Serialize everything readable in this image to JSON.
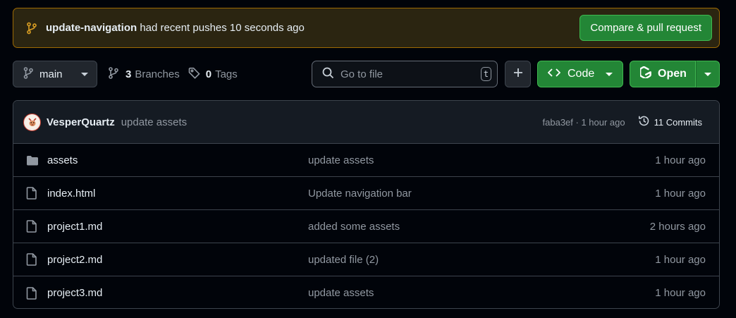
{
  "banner": {
    "branch": "update-navigation",
    "message": "had recent pushes 10 seconds ago",
    "compare_button": "Compare & pull request"
  },
  "toolbar": {
    "branch_selector": "main",
    "branches_count": "3",
    "branches_label": "Branches",
    "tags_count": "0",
    "tags_label": "Tags",
    "search_placeholder": "Go to file",
    "search_shortcut": "t",
    "code_button": "Code",
    "open_button": "Open"
  },
  "latest_commit": {
    "author": "VesperQuartz",
    "message": "update assets",
    "hash_time": "faba3ef · 1 hour ago",
    "commits_label": "11 Commits"
  },
  "files": [
    {
      "name": "assets",
      "type": "folder",
      "message": "update assets",
      "time": "1 hour ago"
    },
    {
      "name": "index.html",
      "type": "file",
      "message": "Update navigation bar",
      "time": "1 hour ago"
    },
    {
      "name": "project1.md",
      "type": "file",
      "message": "added some assets",
      "time": "2 hours ago"
    },
    {
      "name": "project2.md",
      "type": "file",
      "message": "updated file (2)",
      "time": "1 hour ago"
    },
    {
      "name": "project3.md",
      "type": "file",
      "message": "update assets",
      "time": "1 hour ago"
    }
  ],
  "colors": {
    "background": "#01040a",
    "banner_bg": "#2b2511",
    "banner_border": "#9e6a03",
    "primary_green": "#238636",
    "muted_text": "#9198a1"
  }
}
